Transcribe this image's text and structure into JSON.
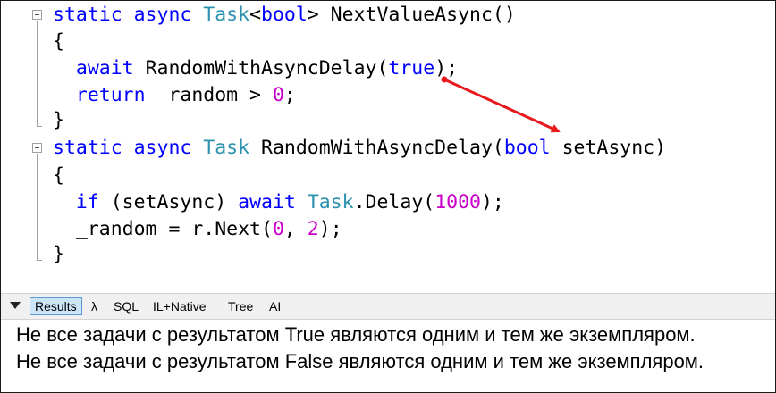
{
  "editor": {
    "lines": [
      [
        {
          "t": "static async ",
          "c": "kw"
        },
        {
          "t": "Task",
          "c": "type"
        },
        {
          "t": "<",
          "c": "plain"
        },
        {
          "t": "bool",
          "c": "kw"
        },
        {
          "t": "> NextValueAsync()",
          "c": "plain"
        }
      ],
      [
        {
          "t": "{",
          "c": "plain"
        }
      ],
      [
        {
          "t": "  ",
          "c": "plain"
        },
        {
          "t": "await",
          "c": "kw"
        },
        {
          "t": " RandomWithAsyncDelay(",
          "c": "plain"
        },
        {
          "t": "true",
          "c": "kw"
        },
        {
          "t": ");",
          "c": "plain"
        }
      ],
      [
        {
          "t": "  ",
          "c": "plain"
        },
        {
          "t": "return",
          "c": "kw"
        },
        {
          "t": " _random > ",
          "c": "plain"
        },
        {
          "t": "0",
          "c": "num"
        },
        {
          "t": ";",
          "c": "plain"
        }
      ],
      [
        {
          "t": "}",
          "c": "plain"
        }
      ],
      [
        {
          "t": "static async ",
          "c": "kw"
        },
        {
          "t": "Task",
          "c": "type"
        },
        {
          "t": " RandomWithAsyncDelay(",
          "c": "plain"
        },
        {
          "t": "bool",
          "c": "kw"
        },
        {
          "t": " setAsync)",
          "c": "plain"
        }
      ],
      [
        {
          "t": "{",
          "c": "plain"
        }
      ],
      [
        {
          "t": "  ",
          "c": "plain"
        },
        {
          "t": "if",
          "c": "kw"
        },
        {
          "t": " (setAsync) ",
          "c": "plain"
        },
        {
          "t": "await",
          "c": "kw"
        },
        {
          "t": " ",
          "c": "plain"
        },
        {
          "t": "Task",
          "c": "type"
        },
        {
          "t": ".Delay(",
          "c": "plain"
        },
        {
          "t": "1000",
          "c": "num"
        },
        {
          "t": ");",
          "c": "plain"
        }
      ],
      [
        {
          "t": "  _random = r.Next(",
          "c": "plain"
        },
        {
          "t": "0",
          "c": "num"
        },
        {
          "t": ", ",
          "c": "plain"
        },
        {
          "t": "2",
          "c": "num"
        },
        {
          "t": ");",
          "c": "plain"
        }
      ],
      [
        {
          "t": "}",
          "c": "plain"
        }
      ]
    ],
    "annotation_color": "#e8191c"
  },
  "tabs": [
    {
      "label": "Results",
      "active": true
    },
    {
      "label": "λ",
      "active": false
    },
    {
      "label": "SQL",
      "active": false
    },
    {
      "label": "IL+Native",
      "active": false
    },
    {
      "label": "Tree",
      "active": false
    },
    {
      "label": "AI",
      "active": false
    }
  ],
  "output": {
    "line1": "Не все задачи с результатом True являются одним и тем же экземпляром.",
    "line2": "Не все задачи с результатом False являются одним и тем же экземпляром."
  }
}
